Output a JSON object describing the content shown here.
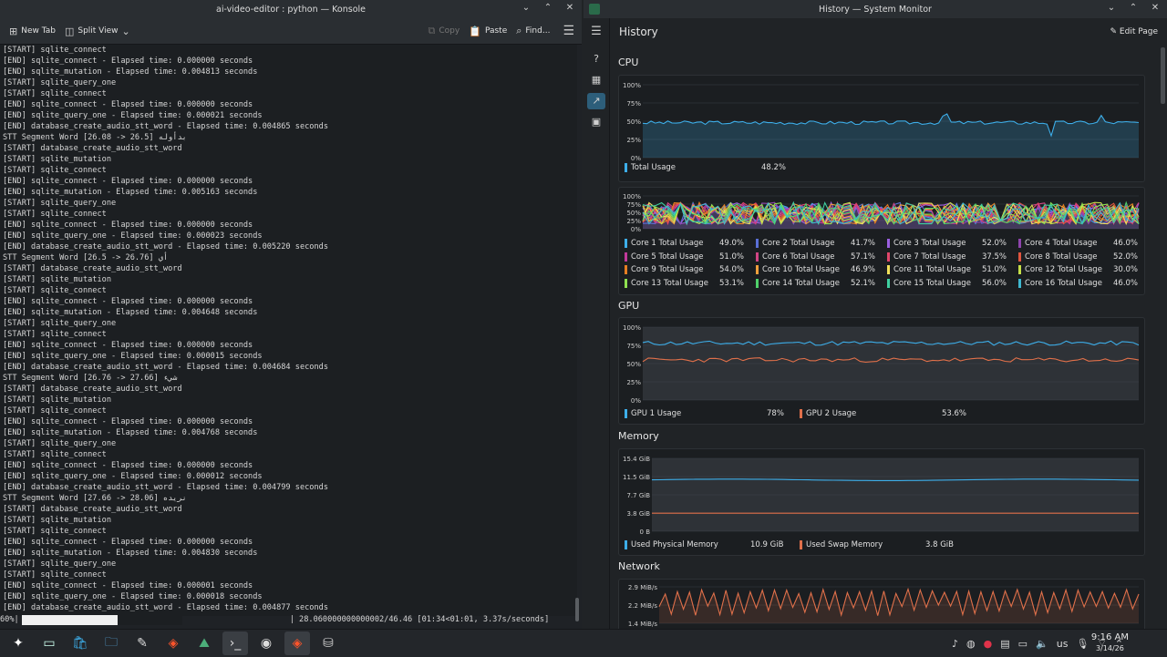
{
  "konsole": {
    "title": "ai-video-editor : python — Konsole",
    "toolbar": {
      "new_tab": "New Tab",
      "split_view": "Split View",
      "copy": "Copy",
      "paste": "Paste",
      "find": "Find..."
    },
    "lines": [
      "[START] sqlite_connect",
      "[END] sqlite_connect - Elapsed time: 0.000000 seconds",
      "[END] sqlite_mutation - Elapsed time: 0.004813 seconds",
      "[START] sqlite_query_one",
      "[START] sqlite_connect",
      "[END] sqlite_connect - Elapsed time: 0.000000 seconds",
      "[END] sqlite_query_one - Elapsed time: 0.000021 seconds",
      "[END] database_create_audio_stt_word - Elapsed time: 0.004865 seconds",
      "STT Segment Word [26.08 -> 26.5] بدأوله",
      "[START] database_create_audio_stt_word",
      "[START] sqlite_mutation",
      "[START] sqlite_connect",
      "[END] sqlite_connect - Elapsed time: 0.000000 seconds",
      "[END] sqlite_mutation - Elapsed time: 0.005163 seconds",
      "[START] sqlite_query_one",
      "[START] sqlite_connect",
      "[END] sqlite_connect - Elapsed time: 0.000000 seconds",
      "[END] sqlite_query_one - Elapsed time: 0.000023 seconds",
      "[END] database_create_audio_stt_word - Elapsed time: 0.005220 seconds",
      "STT Segment Word [26.5 -> 26.76] أي",
      "[START] database_create_audio_stt_word",
      "[START] sqlite_mutation",
      "[START] sqlite_connect",
      "[END] sqlite_connect - Elapsed time: 0.000000 seconds",
      "[END] sqlite_mutation - Elapsed time: 0.004648 seconds",
      "[START] sqlite_query_one",
      "[START] sqlite_connect",
      "[END] sqlite_connect - Elapsed time: 0.000000 seconds",
      "[END] sqlite_query_one - Elapsed time: 0.000015 seconds",
      "[END] database_create_audio_stt_word - Elapsed time: 0.004684 seconds",
      "STT Segment Word [26.76 -> 27.66] شيء",
      "[START] database_create_audio_stt_word",
      "[START] sqlite_mutation",
      "[START] sqlite_connect",
      "[END] sqlite_connect - Elapsed time: 0.000000 seconds",
      "[END] sqlite_mutation - Elapsed time: 0.004768 seconds",
      "[START] sqlite_query_one",
      "[START] sqlite_connect",
      "[END] sqlite_connect - Elapsed time: 0.000000 seconds",
      "[END] sqlite_query_one - Elapsed time: 0.000012 seconds",
      "[END] database_create_audio_stt_word - Elapsed time: 0.004799 seconds",
      "STT Segment Word [27.66 -> 28.06] نريده",
      "[START] database_create_audio_stt_word",
      "[START] sqlite_mutation",
      "[START] sqlite_connect",
      "[END] sqlite_connect - Elapsed time: 0.000000 seconds",
      "[END] sqlite_mutation - Elapsed time: 0.004830 seconds",
      "[START] sqlite_query_one",
      "[START] sqlite_connect",
      "[END] sqlite_connect - Elapsed time: 0.000001 seconds",
      "[END] sqlite_query_one - Elapsed time: 0.000018 seconds",
      "[END] database_create_audio_stt_word - Elapsed time: 0.004877 seconds"
    ],
    "progress": {
      "percent_label": " 60%|",
      "fraction": 0.6,
      "tail": "| 28.060000000000002/46.46 [01:34<01:01,  3.37s/seconds]"
    }
  },
  "sysmon": {
    "title": "History — System Monitor",
    "page_title": "History",
    "edit_page": "Edit Page",
    "sections": {
      "cpu": "CPU",
      "gpu": "GPU",
      "memory": "Memory",
      "network": "Network"
    },
    "cpu_total": {
      "ticks": [
        "100%",
        "75%",
        "50%",
        "25%",
        "0%"
      ],
      "legend_label": "Total Usage",
      "legend_value": "48.2%",
      "color": "#3daee9"
    },
    "cpu_cores": {
      "ticks": [
        "100%",
        "75%",
        "50%",
        "25%",
        "0%"
      ],
      "legend": [
        {
          "label": "Core 1 Total Usage",
          "value": "49.0%",
          "color": "#3daee9"
        },
        {
          "label": "Core 2 Total Usage",
          "value": "41.7%",
          "color": "#5a6fd6"
        },
        {
          "label": "Core 3 Total Usage",
          "value": "52.0%",
          "color": "#9b5fe0"
        },
        {
          "label": "Core 4 Total Usage",
          "value": "46.0%",
          "color": "#8e44ad"
        },
        {
          "label": "Core 5 Total Usage",
          "value": "51.0%",
          "color": "#c0399b"
        },
        {
          "label": "Core 6 Total Usage",
          "value": "57.1%",
          "color": "#d04484"
        },
        {
          "label": "Core 7 Total Usage",
          "value": "37.5%",
          "color": "#e0466a"
        },
        {
          "label": "Core 8 Total Usage",
          "value": "52.0%",
          "color": "#e0553f"
        },
        {
          "label": "Core 9 Total Usage",
          "value": "54.0%",
          "color": "#e67e22"
        },
        {
          "label": "Core 10 Total Usage",
          "value": "46.9%",
          "color": "#f0a03c"
        },
        {
          "label": "Core 11 Total Usage",
          "value": "51.0%",
          "color": "#f1e05a"
        },
        {
          "label": "Core 12 Total Usage",
          "value": "30.0%",
          "color": "#c6e048"
        },
        {
          "label": "Core 13 Total Usage",
          "value": "53.1%",
          "color": "#8fe050"
        },
        {
          "label": "Core 14 Total Usage",
          "value": "52.1%",
          "color": "#4fd06a"
        },
        {
          "label": "Core 15 Total Usage",
          "value": "56.0%",
          "color": "#3fd0a0"
        },
        {
          "label": "Core 16 Total Usage",
          "value": "46.0%",
          "color": "#3fb8d0"
        }
      ]
    },
    "gpu": {
      "ticks": [
        "100%",
        "75%",
        "50%",
        "25%",
        "0%"
      ],
      "legend": [
        {
          "label": "GPU 1 Usage",
          "value": "78%",
          "color": "#3daee9"
        },
        {
          "label": "GPU 2 Usage",
          "value": "53.6%",
          "color": "#e0704a"
        }
      ]
    },
    "memory": {
      "ticks": [
        "15.4 GiB",
        "11.5 GiB",
        "7.7 GiB",
        "3.8 GiB",
        "0 B"
      ],
      "legend": [
        {
          "label": "Used Physical Memory",
          "value": "10.9 GiB",
          "color": "#3daee9"
        },
        {
          "label": "Used Swap Memory",
          "value": "3.8 GiB",
          "color": "#e0704a"
        }
      ]
    },
    "network": {
      "ticks": [
        "2.9 MiB/s",
        "2.2 MiB/s",
        "1.4 MiB/s"
      ],
      "color": "#e0704a"
    }
  },
  "taskbar": {
    "keyboard_layout": "us",
    "time": "9:16 AM",
    "date": "3/14/26"
  }
}
